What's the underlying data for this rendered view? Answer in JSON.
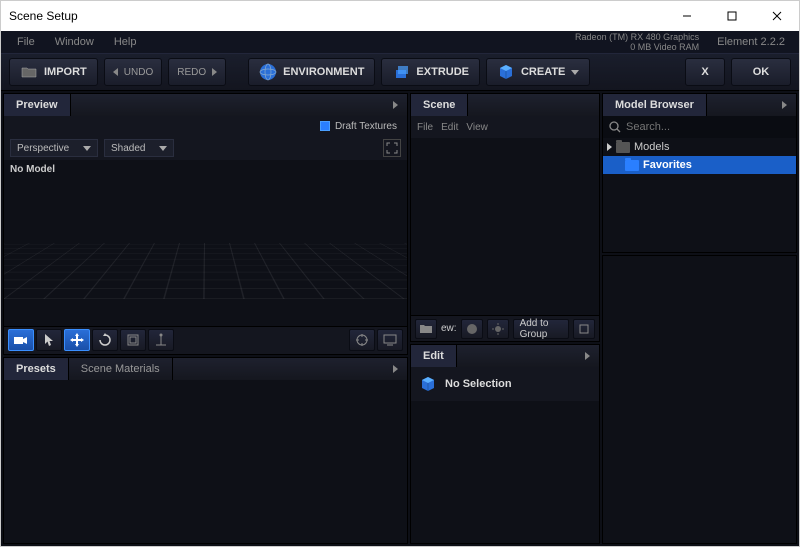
{
  "window": {
    "title": "Scene Setup"
  },
  "menubar": {
    "items": [
      "File",
      "Window",
      "Help"
    ],
    "gpu_name": "Radeon (TM) RX 480 Graphics",
    "gpu_vram": "0 MB Video RAM",
    "brand": "Element",
    "version": "2.2.2"
  },
  "toolbar": {
    "import": "IMPORT",
    "undo": "UNDO",
    "redo": "REDO",
    "environment": "ENVIRONMENT",
    "extrude": "EXTRUDE",
    "create": "CREATE",
    "cancel": "X",
    "ok": "OK"
  },
  "preview": {
    "tab": "Preview",
    "draft_textures": "Draft Textures",
    "perspective": "Perspective",
    "shaded": "Shaded",
    "no_model": "No Model"
  },
  "presets": {
    "tab1": "Presets",
    "tab2": "Scene Materials"
  },
  "scene": {
    "tab": "Scene",
    "sub": [
      "File",
      "Edit",
      "View"
    ],
    "new_label": "ew:",
    "add_to_group": "Add to Group"
  },
  "edit": {
    "tab": "Edit",
    "no_selection": "No Selection"
  },
  "browser": {
    "tab": "Model Browser",
    "search_placeholder": "Search...",
    "items": [
      {
        "label": "Models"
      },
      {
        "label": "Favorites"
      }
    ]
  }
}
